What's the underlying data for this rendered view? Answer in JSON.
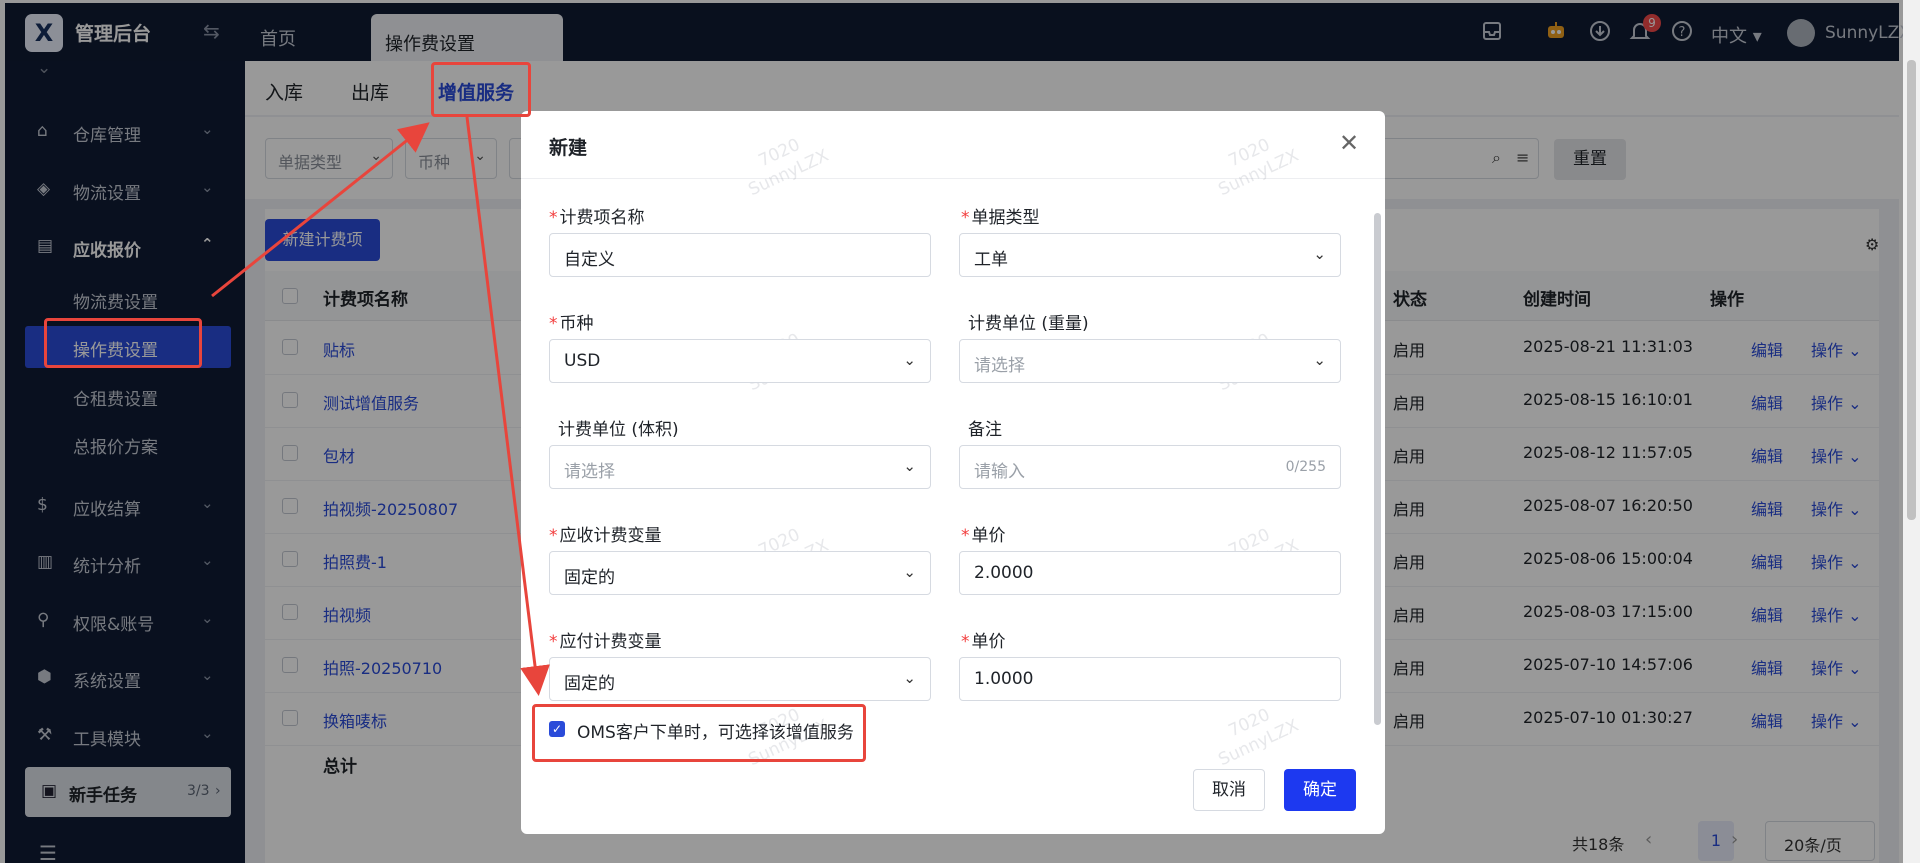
{
  "topbar": {
    "logo": "X",
    "app_title": "管理后台",
    "collapse_icon": "⇆",
    "tabs": [
      {
        "label": "首页"
      },
      {
        "label": "操作费设置"
      }
    ],
    "language": "中文",
    "notification_count": "9",
    "username": "SunnyLZX"
  },
  "sidebar": {
    "items": [
      {
        "icon": "warehouse-icon",
        "label": "仓库管理"
      },
      {
        "icon": "logistics-icon",
        "label": "物流设置"
      },
      {
        "icon": "receivable-quote-icon",
        "label": "应收报价"
      },
      {
        "icon": "receivable-settlement-icon",
        "label": "应收结算"
      },
      {
        "icon": "statistics-icon",
        "label": "统计分析"
      },
      {
        "icon": "permissions-icon",
        "label": "权限&账号"
      },
      {
        "icon": "system-settings-icon",
        "label": "系统设置"
      },
      {
        "icon": "tools-icon",
        "label": "工具模块"
      }
    ],
    "subitems": [
      {
        "label": "物流费设置"
      },
      {
        "label": "操作费设置"
      },
      {
        "label": "仓租费设置"
      },
      {
        "label": "总报价方案"
      }
    ],
    "newbie": {
      "label": "新手任务",
      "count": "3/3"
    }
  },
  "main": {
    "subtabs": [
      {
        "label": "入库"
      },
      {
        "label": "出库"
      },
      {
        "label": "增值服务"
      }
    ],
    "filters": {
      "doc_type": "单据类型",
      "currency": "币种"
    },
    "reset_label": "重置",
    "new_fee_label": "新建计费项",
    "columns": {
      "name": "计费项名称",
      "status": "状态",
      "created": "创建时间",
      "actions": "操作"
    },
    "rows": [
      {
        "name": "贴标",
        "status": "启用",
        "created": "2025-08-21 11:31:03",
        "edit": "编辑",
        "op": "操作"
      },
      {
        "name": "测试增值服务",
        "status": "启用",
        "created": "2025-08-15 16:10:01",
        "edit": "编辑",
        "op": "操作"
      },
      {
        "name": "包材",
        "status": "启用",
        "created": "2025-08-12 11:57:05",
        "edit": "编辑",
        "op": "操作"
      },
      {
        "name": "拍视频-20250807",
        "status": "启用",
        "created": "2025-08-07 16:20:50",
        "edit": "编辑",
        "op": "操作"
      },
      {
        "name": "拍照费-1",
        "status": "启用",
        "created": "2025-08-06 15:00:04",
        "edit": "编辑",
        "op": "操作"
      },
      {
        "name": "拍视频",
        "status": "启用",
        "created": "2025-08-03 17:15:00",
        "edit": "编辑",
        "op": "操作"
      },
      {
        "name": "拍照-20250710",
        "status": "启用",
        "created": "2025-07-10 14:57:06",
        "edit": "编辑",
        "op": "操作"
      },
      {
        "name": "换箱唛标",
        "status": "启用",
        "created": "2025-07-10 01:30:27",
        "edit": "编辑",
        "op": "操作"
      }
    ],
    "total_label": "总计",
    "pagination": {
      "total": "共18条",
      "current": "1",
      "page_size": "20条/页"
    }
  },
  "modal": {
    "title": "新建",
    "watermark": "7020\nSunnyLZX",
    "fields": {
      "fee_name": {
        "label": "计费项名称",
        "value": "自定义"
      },
      "doc_type": {
        "label": "单据类型",
        "value": "工单"
      },
      "currency": {
        "label": "币种",
        "value": "USD"
      },
      "weight_unit": {
        "label": "计费单位 (重量)",
        "placeholder": "请选择"
      },
      "volume_unit": {
        "label": "计费单位 (体积)",
        "placeholder": "请选择"
      },
      "remark": {
        "label": "备注",
        "placeholder": "请输入",
        "counter": "0/255"
      },
      "receivable_var": {
        "label": "应收计费变量",
        "value": "固定的"
      },
      "receivable_price": {
        "label": "单价",
        "value": "2.0000"
      },
      "payable_var": {
        "label": "应付计费变量",
        "value": "固定的"
      },
      "payable_price": {
        "label": "单价",
        "value": "1.0000"
      }
    },
    "oms_checkbox": {
      "checked": true,
      "label": "OMS客户下单时，可选择该增值服务"
    },
    "cancel_label": "取消",
    "ok_label": "确定"
  },
  "colors": {
    "primary": "#2a4bd9",
    "confirm": "#1d39f0",
    "sidebar_bg": "#101c35",
    "required": "#f23d3d",
    "annotation": "#e8453c"
  }
}
